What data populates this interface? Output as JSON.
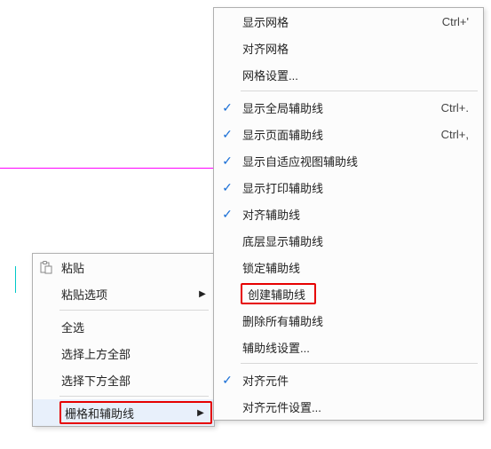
{
  "context_menu": {
    "items": [
      {
        "label": "粘贴"
      },
      {
        "label": "粘贴选项"
      },
      {
        "label": "全选"
      },
      {
        "label": "选择上方全部"
      },
      {
        "label": "选择下方全部"
      },
      {
        "label": "栅格和辅助线"
      }
    ]
  },
  "submenu": {
    "items": [
      {
        "label": "显示网格",
        "shortcut": "Ctrl+'"
      },
      {
        "label": "对齐网格"
      },
      {
        "label": "网格设置..."
      },
      {
        "label": "显示全局辅助线",
        "shortcut": "Ctrl+."
      },
      {
        "label": "显示页面辅助线",
        "shortcut": "Ctrl+,"
      },
      {
        "label": "显示自适应视图辅助线"
      },
      {
        "label": "显示打印辅助线"
      },
      {
        "label": "对齐辅助线"
      },
      {
        "label": "底层显示辅助线"
      },
      {
        "label": "锁定辅助线"
      },
      {
        "label": "创建辅助线"
      },
      {
        "label": "删除所有辅助线"
      },
      {
        "label": "辅助线设置..."
      },
      {
        "label": "对齐元件"
      },
      {
        "label": "对齐元件设置..."
      }
    ]
  }
}
